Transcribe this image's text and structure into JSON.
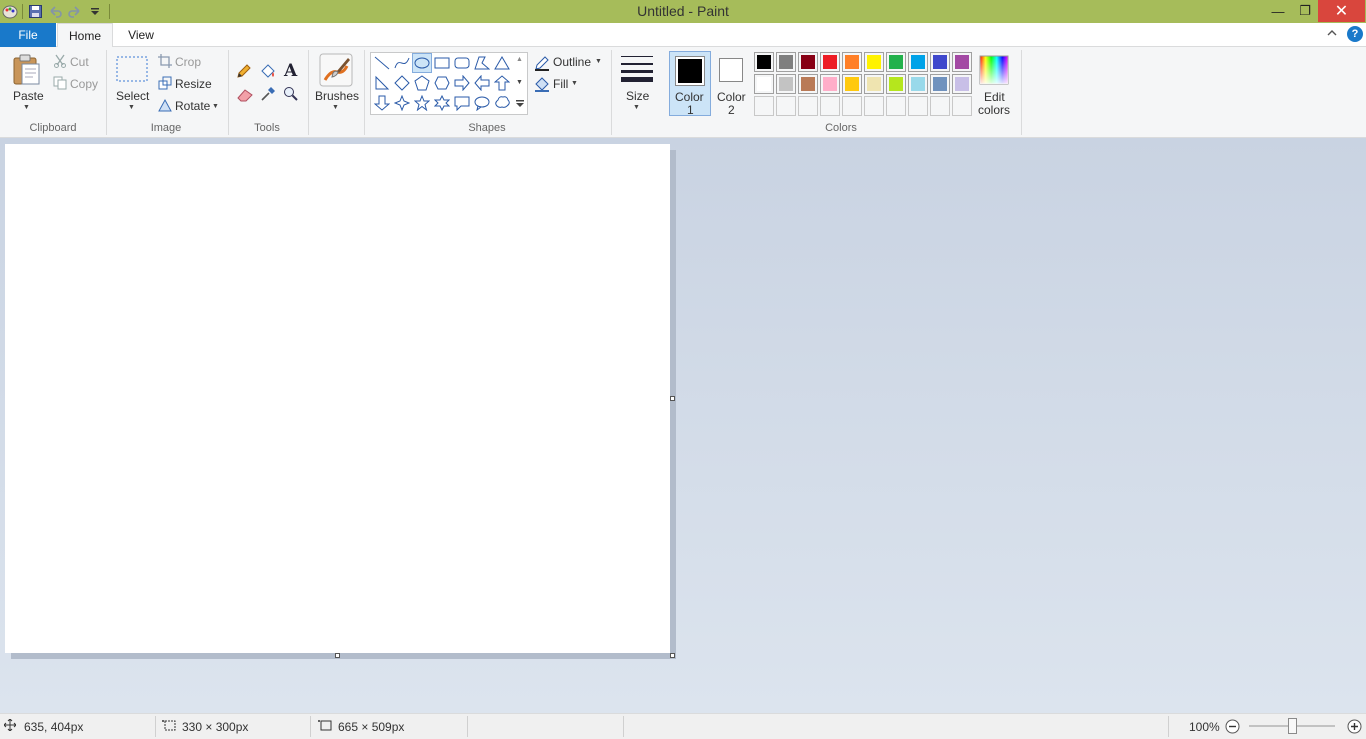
{
  "app": {
    "title": "Untitled - Paint"
  },
  "window_controls": {
    "minimize": "—",
    "restore": "❐",
    "close": "✕"
  },
  "menu": {
    "file": "File",
    "home": "Home",
    "view": "View",
    "help": "?"
  },
  "ribbon": {
    "clipboard": {
      "label": "Clipboard",
      "paste": "Paste",
      "cut": "Cut",
      "copy": "Copy"
    },
    "image": {
      "label": "Image",
      "select": "Select",
      "crop": "Crop",
      "resize": "Resize",
      "rotate": "Rotate"
    },
    "tools": {
      "label": "Tools"
    },
    "brushes": {
      "label": "Brushes"
    },
    "shapes": {
      "label": "Shapes",
      "outline": "Outline",
      "fill": "Fill"
    },
    "size": {
      "label": "Size"
    },
    "colors": {
      "label": "Colors",
      "color1_line1": "Color",
      "color1_line2": "1",
      "color2_line1": "Color",
      "color2_line2": "2",
      "edit_line1": "Edit",
      "edit_line2": "colors",
      "color1_value": "#000000",
      "color2_value": "#ffffff",
      "palette_row1": [
        "#000000",
        "#7f7f7f",
        "#880015",
        "#ed1c24",
        "#ff7f27",
        "#fff200",
        "#22b14c",
        "#00a2e8",
        "#3f48cc",
        "#a349a4"
      ],
      "palette_row2": [
        "#ffffff",
        "#c3c3c3",
        "#b97a57",
        "#ffaec9",
        "#ffc90e",
        "#efe4b0",
        "#b5e61d",
        "#99d9ea",
        "#7092be",
        "#c8bfe7"
      ]
    }
  },
  "status": {
    "cursor_pos": "635, 404px",
    "selection_size": "330 × 300px",
    "image_size": "665 × 509px",
    "zoom": "100%"
  }
}
